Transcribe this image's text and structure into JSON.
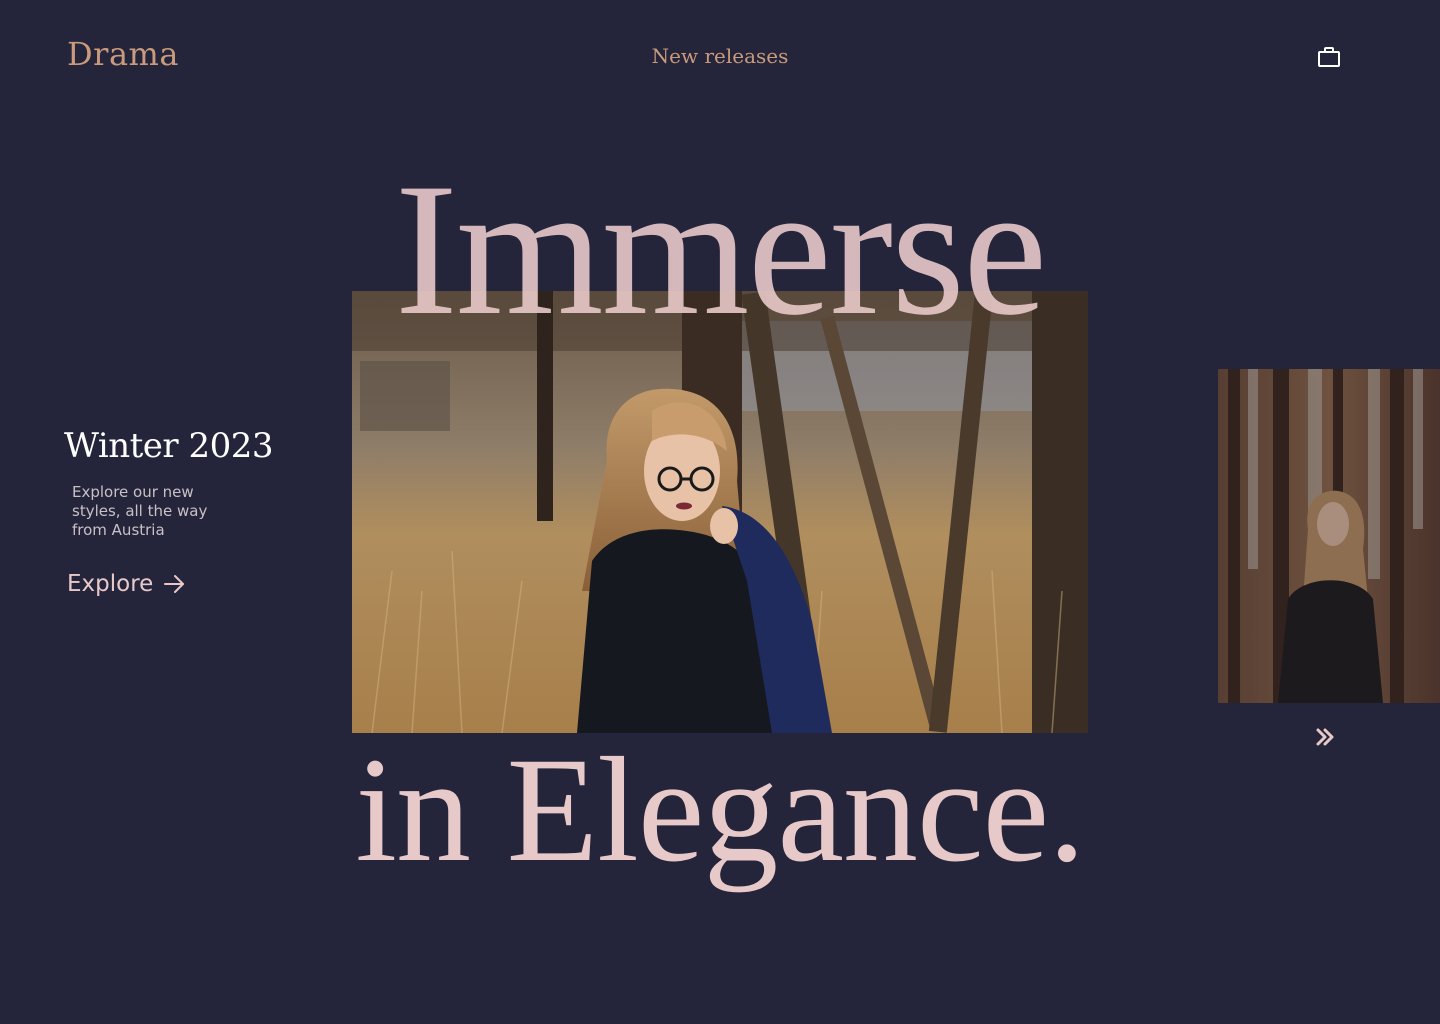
{
  "header": {
    "logo": "Drama",
    "nav_link": "New releases",
    "cart_icon": "shopping-bag-icon"
  },
  "hero": {
    "headline_top": "Immerse",
    "headline_bottom": "in Elegance.",
    "photo_alt": "Woman with glasses in winter field"
  },
  "collection": {
    "title": "Winter 2023",
    "description": "Explore our new styles, all the way from Austria",
    "cta_label": "Explore",
    "cta_icon": "arrow-right-icon"
  },
  "carousel": {
    "next_icon": "double-chevron-right-icon"
  },
  "colors": {
    "background": "#24253b",
    "accent": "#c99a7c",
    "headline": "#e8c9c9"
  }
}
